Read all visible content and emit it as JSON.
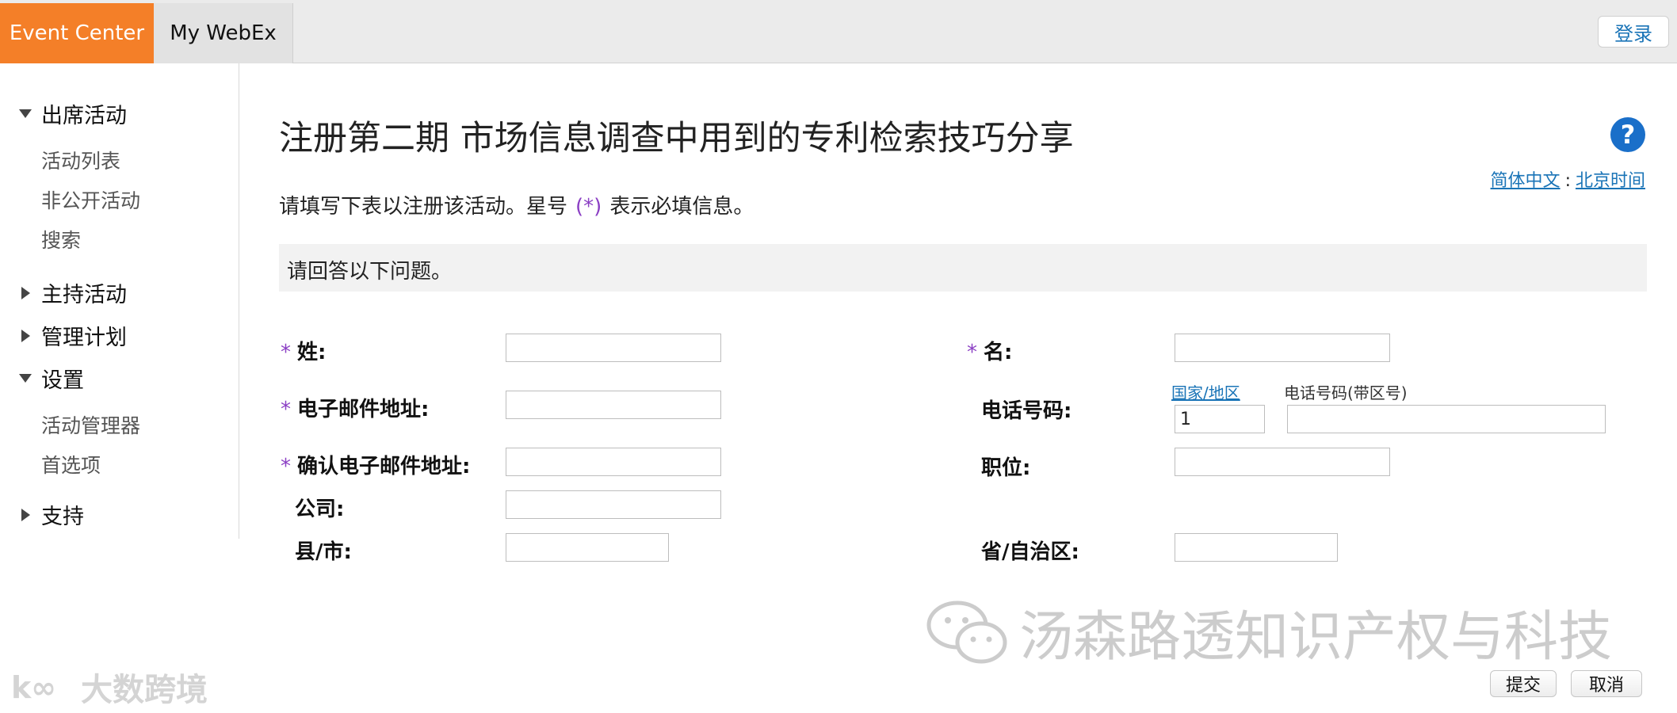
{
  "topbar": {
    "tab_event_center": "Event Center",
    "tab_my_webex": "My WebEx",
    "login_label": "登录"
  },
  "sidebar": {
    "attend": {
      "label": "出席活动",
      "expanded": true,
      "items": [
        "活动列表",
        "非公开活动",
        "搜索"
      ]
    },
    "host": {
      "label": "主持活动",
      "expanded": false
    },
    "manage": {
      "label": "管理计划",
      "expanded": false
    },
    "settings": {
      "label": "设置",
      "expanded": true,
      "items": [
        "活动管理器",
        "首选项"
      ]
    },
    "support": {
      "label": "支持",
      "expanded": false
    }
  },
  "main": {
    "title": "注册第二期 市场信息调查中用到的专利检索技巧分享",
    "locale": {
      "language": "简体中文",
      "separator": ":",
      "timezone": "北京时间"
    },
    "intro_before": "请填写下表以注册该活动。星号",
    "intro_star": "(*)",
    "intro_after": "表示必填信息。",
    "question_bar": "请回答以下问题。"
  },
  "form": {
    "required_mark": "*",
    "last_name_label": "姓:",
    "first_name_label": "名:",
    "email_label": "电子邮件地址:",
    "confirm_email_label": "确认电子邮件地址:",
    "company_label": "公司:",
    "city_label": "县/市:",
    "phone_label": "电话号码:",
    "country_region_link": "国家/地区",
    "phone_area_label": "电话号码(带区号)",
    "country_code_value": "1",
    "job_title_label": "职位:",
    "province_label": "省/自治区:"
  },
  "watermark": {
    "main_text": "汤森路透知识产权与科技",
    "small_text": "大数跨境",
    "small_logo_text": "k∞"
  },
  "buttons": {
    "submit": "提交",
    "cancel": "取消"
  },
  "colors": {
    "accent_orange": "#f47f28",
    "link_blue": "#1a74b7",
    "required_purple": "#8b3fc4",
    "help_blue": "#1a6fc9"
  },
  "icons": [
    "help-icon",
    "triangle-down-icon",
    "triangle-right-icon",
    "chat-bubble-icon"
  ]
}
